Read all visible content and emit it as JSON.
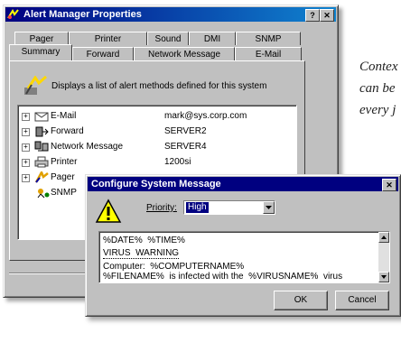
{
  "side_text": [
    "Contex",
    "can be",
    "every j"
  ],
  "main_window": {
    "title": "Alert Manager Properties",
    "help_btn": "?",
    "close_btn": "✕",
    "tabs_back": [
      "Pager",
      "Printer",
      "Sound",
      "DMI",
      "SNMP"
    ],
    "tabs_front": [
      "Summary",
      "Forward",
      "Network Message",
      "E-Mail"
    ],
    "description": "Displays a list of alert methods defined for this system",
    "list": [
      {
        "label": "E-Mail",
        "value": "mark@sys.corp.com",
        "icon": "email-icon"
      },
      {
        "label": "Forward",
        "value": "SERVER2",
        "icon": "forward-icon"
      },
      {
        "label": "Network Message",
        "value": "SERVER4",
        "icon": "network-icon"
      },
      {
        "label": "Printer",
        "value": "1200si",
        "icon": "printer-icon"
      },
      {
        "label": "Pager",
        "value": "",
        "icon": "pager-icon"
      },
      {
        "label": "SNMP",
        "value": "",
        "icon": "snmp-icon"
      }
    ]
  },
  "dialog": {
    "title": "Configure System Message",
    "close_btn": "✕",
    "priority_label": "Priority:",
    "priority_value": "High",
    "message_lines": [
      "%DATE%  %TIME%",
      "VIRUS  WARNING",
      "Computer:  %COMPUTERNAME%",
      "%FILENAME%  is infected with the  %VIRUSNAME%  virus"
    ],
    "ok_label": "OK",
    "cancel_label": "Cancel"
  },
  "colors": {
    "titlebar_active": "#000080",
    "titlebar_gradient_end": "#1084d0",
    "face": "#c0c0c0",
    "highlight_select": "#000080"
  }
}
